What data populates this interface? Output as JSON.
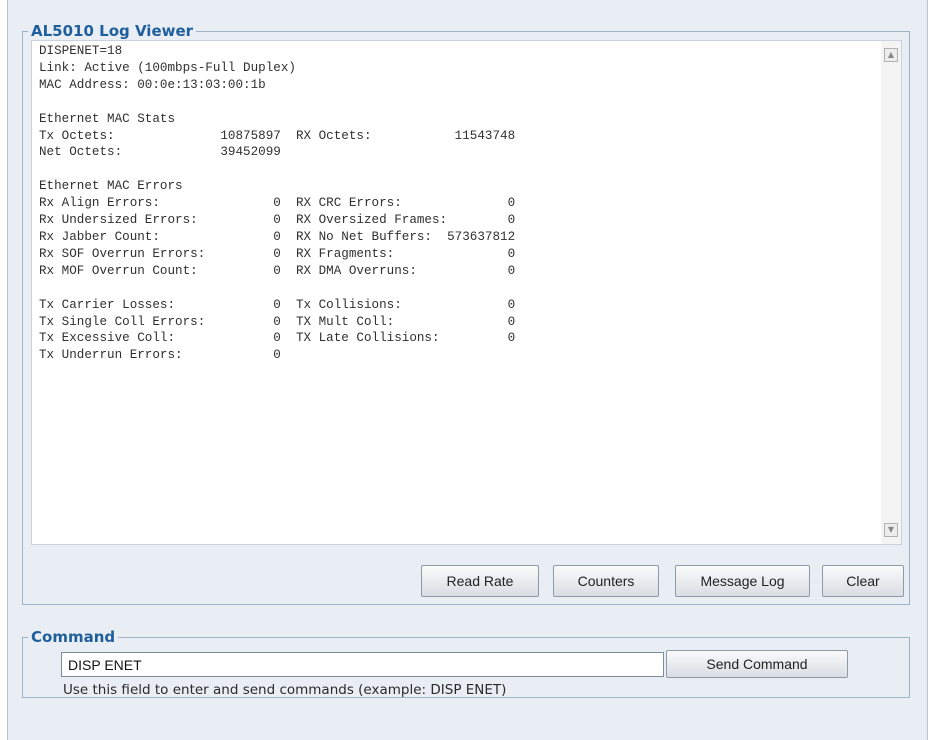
{
  "log_viewer": {
    "title": "AL5010 Log Viewer",
    "log_text": "DISPENET=18\nLink: Active (100mbps-Full Duplex)\nMAC Address: 00:0e:13:03:00:1b\n\nEthernet MAC Stats\nTx Octets:              10875897  RX Octets:           11543748\nNet Octets:             39452099\n\nEthernet MAC Errors\nRx Align Errors:               0  RX CRC Errors:              0\nRx Undersized Errors:          0  RX Oversized Frames:        0\nRx Jabber Count:               0  RX No Net Buffers:  573637812\nRx SOF Overrun Errors:         0  RX Fragments:               0\nRx MOF Overrun Count:          0  RX DMA Overruns:            0\n\nTx Carrier Losses:             0  Tx Collisions:              0\nTx Single Coll Errors:         0  TX Mult Coll:               0\nTx Excessive Coll:             0  TX Late Collisions:         0\nTx Underrun Errors:            0",
    "scroll_up_icon": "scroll-up-arrow",
    "scroll_down_icon": "scroll-down-arrow",
    "buttons": {
      "read_rate": "Read Rate",
      "counters": "Counters",
      "message_log": "Message Log",
      "clear": "Clear"
    }
  },
  "command": {
    "title": "Command",
    "input_value": "DISP ENET",
    "send_label": "Send Command",
    "help_text": "Use this field to enter and send commands (example: DISP ENET)"
  },
  "colors": {
    "panel_background": "#e8eef4",
    "legend_text": "#1f5f9b",
    "border": "#9fb3c8"
  }
}
